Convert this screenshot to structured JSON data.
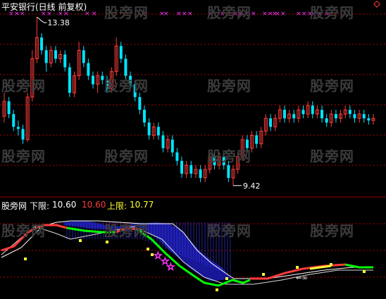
{
  "header": {
    "title": "平安银行(日线 前复权)"
  },
  "price_panel": {
    "high_label": "13.38",
    "low_label": "9.42"
  },
  "indicator_panel": {
    "name": "股旁网",
    "lower_label": "下限:",
    "lower_value": "10.60",
    "mid_value": "10.60",
    "upper_label": "上限:",
    "upper_value": "10.77"
  },
  "watermark": "股旁网",
  "colors": {
    "background": "#000000",
    "up": "#ff3b3b",
    "down": "#00e5ff",
    "grid": "#b00000",
    "marker": "#ff33ff",
    "accent_yellow": "#ffff33",
    "line_green": "#00ff00",
    "fill_blue": "#1a1aa8"
  },
  "chart_data": {
    "type": "candlestick",
    "series_count": 90,
    "high": 13.38,
    "low": 9.42,
    "candles": [
      [
        11.05,
        11.4,
        11.6,
        10.9
      ],
      [
        11.4,
        11.1,
        11.5,
        11.0
      ],
      [
        11.1,
        10.8,
        11.2,
        10.7
      ],
      [
        10.8,
        10.75,
        10.95,
        10.6
      ],
      [
        10.75,
        10.5,
        10.85,
        10.4
      ],
      [
        10.5,
        11.5,
        11.6,
        10.45
      ],
      [
        11.5,
        12.4,
        12.6,
        11.4
      ],
      [
        12.4,
        12.9,
        13.38,
        12.3
      ],
      [
        12.9,
        12.6,
        13.0,
        12.5
      ],
      [
        12.6,
        12.3,
        12.7,
        12.1
      ],
      [
        12.3,
        12.6,
        12.7,
        12.2
      ],
      [
        12.6,
        12.4,
        12.7,
        12.3
      ],
      [
        12.4,
        12.5,
        12.6,
        12.3
      ],
      [
        12.5,
        12.2,
        12.6,
        12.1
      ],
      [
        12.2,
        11.6,
        12.3,
        11.5
      ],
      [
        11.6,
        12.0,
        12.1,
        11.5
      ],
      [
        12.0,
        12.6,
        12.8,
        11.9
      ],
      [
        12.6,
        12.3,
        12.7,
        12.2
      ],
      [
        12.3,
        12.0,
        12.4,
        11.9
      ],
      [
        12.0,
        11.8,
        12.1,
        11.7
      ],
      [
        11.8,
        12.0,
        12.1,
        11.6
      ],
      [
        12.0,
        11.9,
        12.1,
        11.8
      ],
      [
        11.9,
        11.7,
        12.0,
        11.6
      ],
      [
        11.7,
        12.1,
        12.2,
        11.6
      ],
      [
        12.1,
        12.7,
        12.9,
        12.0
      ],
      [
        12.7,
        12.4,
        12.8,
        12.3
      ],
      [
        12.4,
        12.0,
        12.5,
        11.9
      ],
      [
        12.0,
        11.8,
        12.1,
        11.7
      ],
      [
        11.8,
        11.5,
        11.9,
        11.4
      ],
      [
        11.5,
        11.2,
        11.6,
        11.1
      ],
      [
        11.2,
        10.9,
        11.3,
        10.8
      ],
      [
        10.9,
        10.6,
        11.0,
        10.5
      ],
      [
        10.6,
        10.8,
        10.9,
        10.5
      ],
      [
        10.8,
        10.6,
        10.9,
        10.5
      ],
      [
        10.6,
        10.3,
        10.7,
        10.2
      ],
      [
        10.3,
        10.5,
        10.6,
        10.2
      ],
      [
        10.5,
        10.2,
        10.6,
        10.1
      ],
      [
        10.2,
        10.0,
        10.3,
        9.9
      ],
      [
        10.0,
        9.7,
        10.1,
        9.6
      ],
      [
        9.7,
        9.9,
        10.0,
        9.6
      ],
      [
        9.9,
        9.7,
        10.0,
        9.6
      ],
      [
        9.7,
        9.8,
        9.9,
        9.6
      ],
      [
        9.8,
        9.6,
        9.9,
        9.5
      ],
      [
        9.6,
        9.8,
        9.9,
        9.5
      ],
      [
        9.8,
        10.1,
        10.2,
        9.7
      ],
      [
        10.1,
        9.9,
        10.2,
        9.8
      ],
      [
        9.9,
        10.1,
        10.2,
        9.8
      ],
      [
        10.1,
        9.9,
        10.2,
        9.8
      ],
      [
        9.9,
        9.6,
        10.0,
        9.5
      ],
      [
        9.6,
        9.8,
        9.9,
        9.42
      ],
      [
        9.8,
        10.1,
        10.2,
        9.7
      ],
      [
        10.1,
        10.5,
        10.6,
        10.0
      ],
      [
        10.5,
        10.3,
        10.6,
        10.2
      ],
      [
        10.3,
        10.6,
        10.7,
        10.2
      ],
      [
        10.6,
        10.4,
        10.7,
        10.3
      ],
      [
        10.4,
        10.7,
        10.8,
        10.3
      ],
      [
        10.7,
        11.0,
        11.1,
        10.6
      ],
      [
        11.0,
        10.8,
        11.1,
        10.7
      ],
      [
        10.8,
        11.0,
        11.1,
        10.7
      ],
      [
        11.0,
        11.2,
        11.3,
        10.9
      ],
      [
        11.2,
        11.0,
        11.3,
        10.9
      ],
      [
        11.0,
        11.1,
        11.2,
        10.9
      ],
      [
        11.1,
        11.0,
        11.2,
        10.9
      ],
      [
        11.0,
        11.2,
        11.3,
        10.9
      ],
      [
        11.2,
        11.1,
        11.3,
        11.0
      ],
      [
        11.1,
        11.3,
        11.4,
        11.0
      ],
      [
        11.3,
        11.1,
        11.4,
        11.0
      ],
      [
        11.1,
        11.2,
        11.3,
        11.0
      ],
      [
        11.2,
        11.0,
        11.3,
        10.9
      ],
      [
        11.0,
        10.9,
        11.1,
        10.8
      ],
      [
        10.9,
        11.1,
        11.2,
        10.8
      ],
      [
        11.1,
        11.0,
        11.2,
        10.9
      ],
      [
        11.0,
        11.1,
        11.2,
        10.9
      ],
      [
        11.1,
        11.2,
        11.3,
        11.0
      ],
      [
        11.2,
        11.1,
        11.3,
        11.0
      ],
      [
        11.1,
        11.0,
        11.2,
        10.9
      ],
      [
        11.0,
        11.1,
        11.2,
        10.9
      ],
      [
        11.1,
        11.0,
        11.2,
        10.9
      ],
      [
        11.0,
        10.95,
        11.1,
        10.85
      ],
      [
        10.95,
        11.0,
        11.1,
        10.85
      ]
    ]
  }
}
